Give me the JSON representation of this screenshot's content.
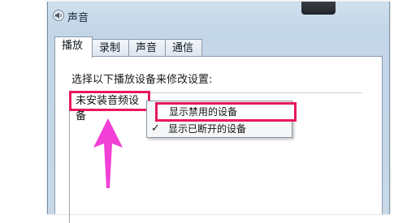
{
  "window": {
    "title": "声音",
    "icon": "speaker-icon"
  },
  "tabs": [
    {
      "label": "播放",
      "active": true
    },
    {
      "label": "录制",
      "active": false
    },
    {
      "label": "声音",
      "active": false
    },
    {
      "label": "通信",
      "active": false
    }
  ],
  "panel": {
    "instruction": "选择以下播放设备来修改设置:",
    "empty_label": "未安装音频设备"
  },
  "context_menu": {
    "items": [
      {
        "label": "显示禁用的设备",
        "checked": false,
        "highlighted": true
      },
      {
        "label": "显示已断开的设备",
        "checked": true,
        "check_glyph": "✓",
        "highlighted": false
      }
    ]
  },
  "annotation": {
    "highlight_color": "#e8185c",
    "arrow_color": "#f23fd6"
  }
}
